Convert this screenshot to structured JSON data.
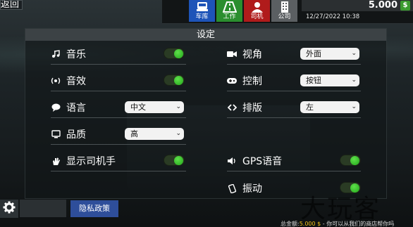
{
  "header": {
    "back_label": "返回",
    "nav": [
      {
        "label": "车库",
        "color": "#1e54b8",
        "icon": "truck-icon"
      },
      {
        "label": "工作",
        "color": "#2a8e2e",
        "icon": "road-icon"
      },
      {
        "label": "司机",
        "color": "#b01b1b",
        "icon": "person-icon"
      },
      {
        "label": "公司",
        "color": "#5b5f62",
        "icon": "building-icon"
      }
    ],
    "money": "5.000",
    "money_icon": "$",
    "datetime": "12/27/2022 10:38"
  },
  "panel": {
    "title": "设定",
    "left": [
      {
        "label": "音乐",
        "icon": "music-icon",
        "type": "toggle",
        "value": true
      },
      {
        "label": "音效",
        "icon": "sound-effect-icon",
        "type": "toggle",
        "value": true
      },
      {
        "label": "语言",
        "icon": "chat-bubble-icon",
        "type": "select",
        "value": "中文"
      },
      {
        "label": "品质",
        "icon": "monitor-icon",
        "type": "select",
        "value": "高"
      },
      {
        "label": "显示司机手",
        "icon": "hand-icon",
        "type": "toggle",
        "value": true
      }
    ],
    "right": [
      {
        "label": "视角",
        "icon": "camera-icon",
        "type": "select",
        "value": "外面"
      },
      {
        "label": "控制",
        "icon": "gamepad-icon",
        "type": "select",
        "value": "按钮"
      },
      {
        "label": "排版",
        "icon": "layout-arrows-icon",
        "type": "select",
        "value": "左"
      },
      {
        "label": "GPS语音",
        "icon": "speaker-icon",
        "type": "toggle",
        "value": true
      },
      {
        "label": "振动",
        "icon": "vibrate-icon",
        "type": "toggle",
        "value": true
      }
    ]
  },
  "bottom": {
    "privacy_label": "隐私政策",
    "ticker_prefix": "总金额:",
    "ticker_amount": "5.000 $",
    "ticker_text": "- 你可以从我们的商店帮你吗",
    "watermark": "大玩客"
  }
}
